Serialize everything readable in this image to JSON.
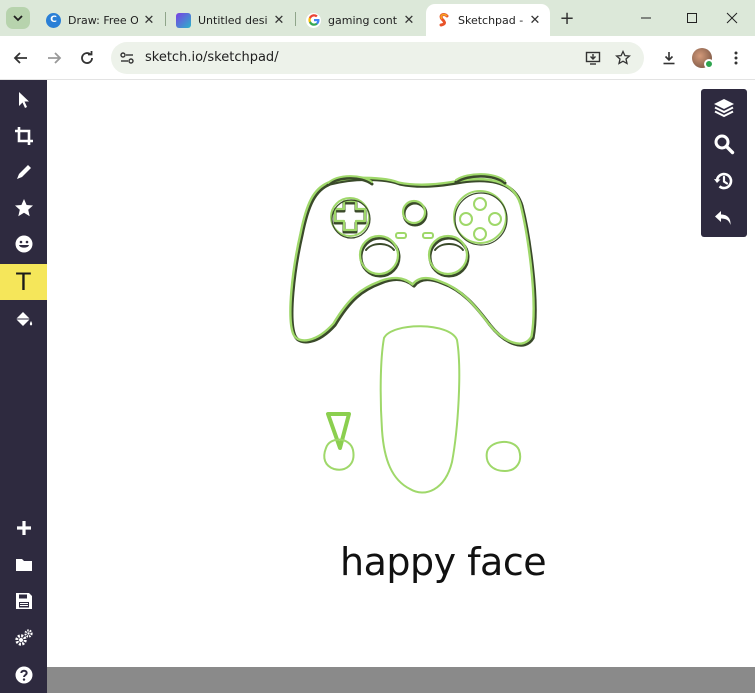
{
  "browser": {
    "tabs": [
      {
        "title": "Draw: Free O",
        "favicon": "canva-c-icon"
      },
      {
        "title": "Untitled desi",
        "favicon": "canva-square-icon"
      },
      {
        "title": "gaming cont",
        "favicon": "google-g-icon"
      },
      {
        "title": "Sketchpad -",
        "favicon": "sketchpad-s-icon",
        "active": true
      }
    ],
    "url": "sketch.io/sketchpad/"
  },
  "sidebar": {
    "tools": [
      {
        "name": "select",
        "icon": "cursor-icon"
      },
      {
        "name": "crop",
        "icon": "crop-icon"
      },
      {
        "name": "pencil",
        "icon": "pencil-icon"
      },
      {
        "name": "stamp",
        "icon": "star-icon"
      },
      {
        "name": "emoji",
        "icon": "emoji-icon"
      },
      {
        "name": "text",
        "icon": "text-icon",
        "label": "T",
        "active": true
      },
      {
        "name": "fill",
        "icon": "paint-bucket-icon"
      }
    ],
    "bottom_tools": [
      {
        "name": "new",
        "icon": "plus-icon"
      },
      {
        "name": "open",
        "icon": "folder-icon"
      },
      {
        "name": "save",
        "icon": "floppy-icon"
      },
      {
        "name": "settings",
        "icon": "gears-icon"
      },
      {
        "name": "help",
        "icon": "help-icon"
      }
    ]
  },
  "right_panel": [
    "layers-icon",
    "zoom-icon",
    "history-icon",
    "undo-icon"
  ],
  "canvas": {
    "caption": "happy face",
    "stroke_color": "#9fd86a"
  },
  "colors": {
    "sidebar_bg": "#2e2a3f",
    "active_tool": "#f5e65a",
    "tab_strip": "#dce8d9"
  }
}
